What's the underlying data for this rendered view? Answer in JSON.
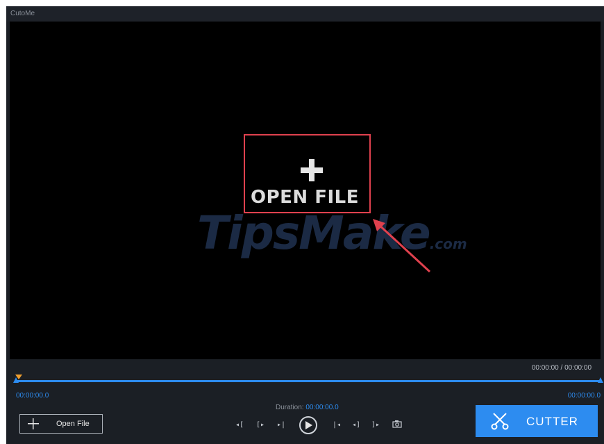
{
  "app": {
    "title": "CutoMe"
  },
  "viewer": {
    "open_file_label": "OPEN FILE",
    "watermark": "TipsMake",
    "watermark_suffix": ".com"
  },
  "timeline": {
    "counter": "00:00:00 / 00:00:00",
    "start_time": "00:00:00.0",
    "end_time": "00:00:00.0"
  },
  "duration": {
    "label": "Duration:",
    "value": "00:00:00.0"
  },
  "controls": {
    "open_file_button": "Open File",
    "cutter_button": "CUTTER",
    "glyphs": {
      "set_start": "◂[",
      "go_start": "[▸",
      "prev_frame": "▸|",
      "next_frame": "|◂",
      "go_end": "◂]",
      "set_end": "]▸"
    }
  },
  "colors": {
    "accent": "#2d8cf0",
    "highlight": "#e0414e",
    "playhead": "#f0a030",
    "background": "#1b1f25"
  }
}
